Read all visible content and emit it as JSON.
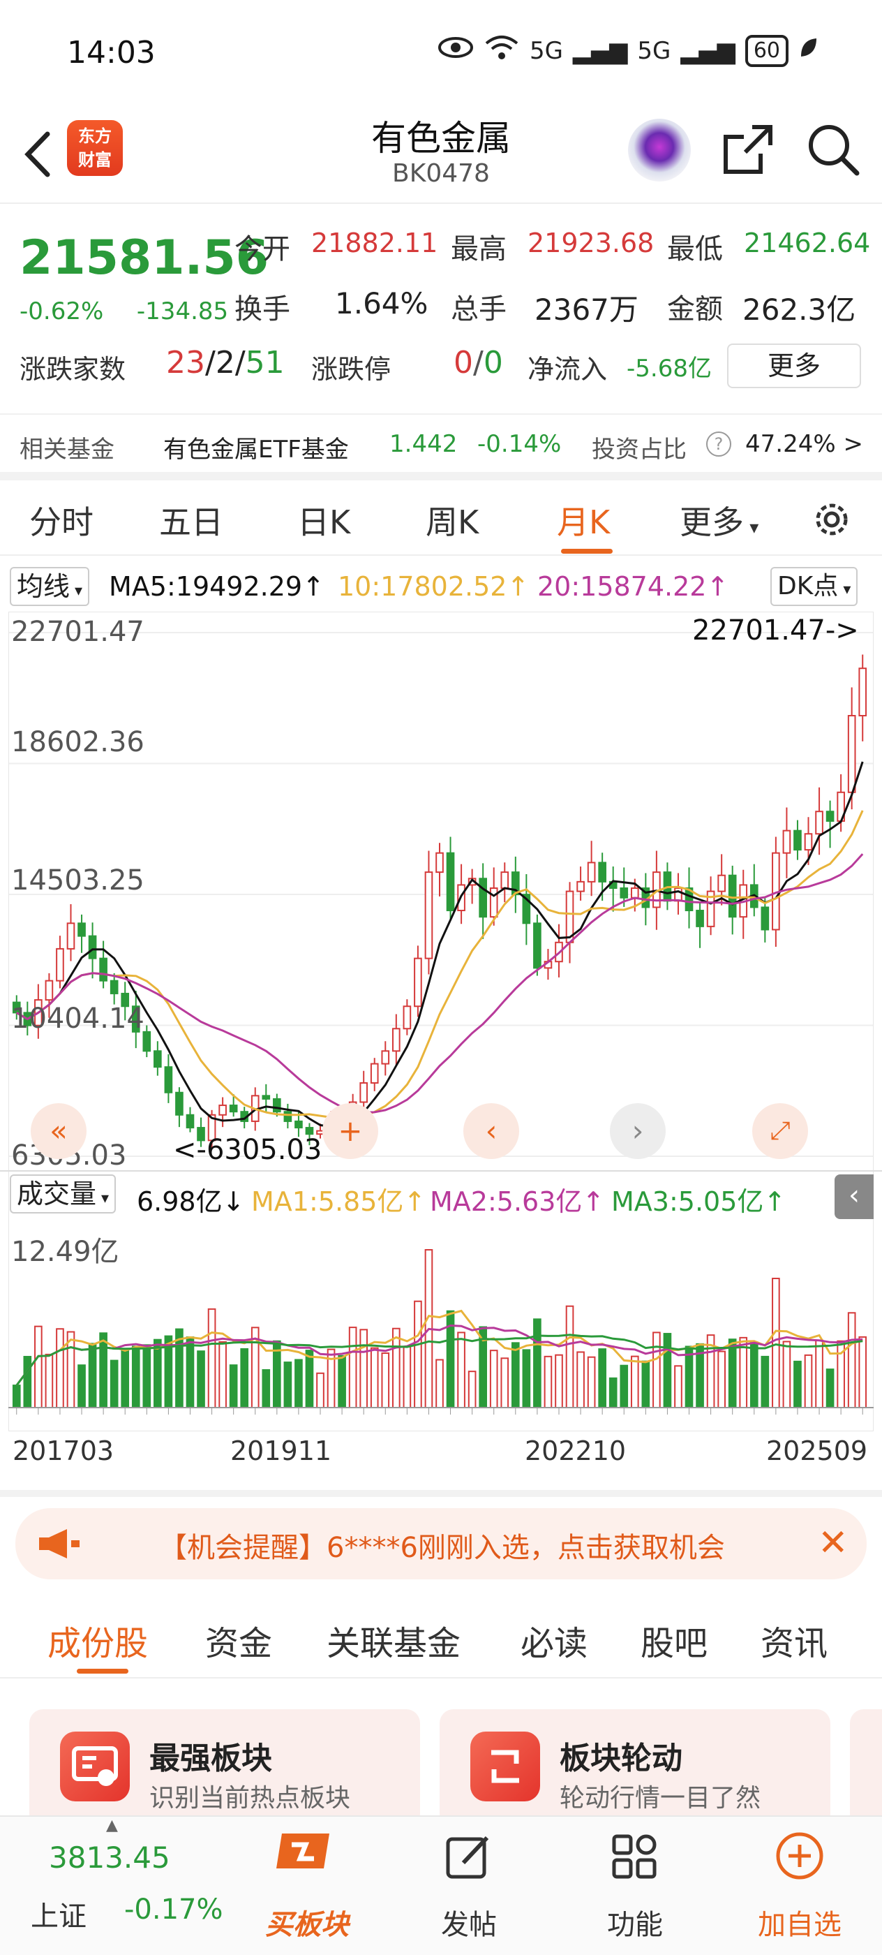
{
  "status_bar": {
    "time": "14:03",
    "battery": "60",
    "signal1": "5G",
    "signal2": "5G"
  },
  "header": {
    "title": "有色金属",
    "code": "BK0478",
    "logo_line1": "东方",
    "logo_line2": "财富"
  },
  "quote": {
    "price": "21581.56",
    "change_pct": "-0.62%",
    "change_abs": "-134.85",
    "open_label": "今开",
    "open": "21882.11",
    "high_label": "最高",
    "high": "21923.68",
    "low_label": "最低",
    "low": "21462.64",
    "turnover_label": "换手",
    "turnover": "1.64%",
    "volume_label": "总手",
    "volume": "2367万",
    "amount_label": "金额",
    "amount": "262.3亿",
    "breadth_label": "涨跌家数",
    "up": "23",
    "flat": "2",
    "down": "51",
    "sep": "/",
    "limit_label": "涨跌停",
    "limit_up": "0",
    "limit_down": "0",
    "netflow_label": "净流入",
    "netflow": "-5.68亿",
    "more": "更多",
    "fund_label": "相关基金",
    "fund_name": "有色金属ETF基金",
    "fund_price": "1.442",
    "fund_change": "-0.14%",
    "ratio_label": "投资占比",
    "ratio": "47.24% >"
  },
  "chart_tabs": [
    "分时",
    "五日",
    "日K",
    "周K",
    "月K",
    "更多"
  ],
  "chart_tabs_active": 4,
  "ma_row": {
    "selector": "均线",
    "ma5": "MA5:19492.29↑",
    "ma10": "10:17802.52↑",
    "ma20": "20:15874.22↑",
    "dk": "DK点"
  },
  "price_axis": [
    "22701.47",
    "18602.36",
    "14503.25",
    "10404.14",
    "6305.03"
  ],
  "max_marker": "22701.47->",
  "min_marker": "<-6305.03",
  "volume_row": {
    "selector": "成交量",
    "value": "6.98亿↓",
    "ma1": "MA1:5.85亿↑",
    "ma2": "MA2:5.63亿↑",
    "ma3": "MA3:5.05亿↑",
    "axis_max": "12.49亿"
  },
  "date_axis": [
    "201703",
    "201911",
    "202210",
    "202509"
  ],
  "colors": {
    "up": "#d53a3a",
    "down": "#2a9a3a",
    "ma5": "#111111",
    "ma10": "#e8b33a",
    "ma20": "#b83a9a",
    "accent": "#e8651e"
  },
  "chart_data": {
    "type": "candlestick",
    "period": "monthly",
    "x_range": [
      "201703",
      "202509"
    ],
    "ylim": [
      6305.03,
      22701.47
    ],
    "y_ticks": [
      22701.47,
      18602.36,
      14503.25,
      10404.14,
      6305.03
    ],
    "close_approx": [
      10800,
      10400,
      11200,
      11800,
      12800,
      13600,
      13200,
      12500,
      11800,
      11400,
      11000,
      10200,
      9600,
      9100,
      8300,
      7600,
      7200,
      6800,
      7600,
      7900,
      7700,
      7400,
      8200,
      8100,
      7700,
      7400,
      7200,
      7000,
      7100,
      7400,
      7300,
      8000,
      8600,
      9200,
      9600,
      10300,
      11000,
      12500,
      15200,
      15800,
      14000,
      14800,
      15000,
      13800,
      14700,
      15200,
      14500,
      13600,
      12200,
      12400,
      13000,
      14600,
      14900,
      15500,
      14900,
      14700,
      14400,
      14700,
      14100,
      15200,
      14300,
      14700,
      14000,
      13500,
      14600,
      15100,
      13800,
      14800,
      14100,
      13400,
      15800,
      16500,
      15900,
      16400,
      17100,
      16800,
      17700,
      20100,
      21582
    ],
    "ma_latest": {
      "MA5": 19492.29,
      "MA10": 17802.52,
      "MA20": 15874.22
    },
    "volume": {
      "ylim_max": "12.49亿",
      "latest": "6.98亿",
      "MA1": "5.85亿",
      "MA2": "5.63亿",
      "MA3": "5.05亿"
    }
  },
  "notice": {
    "text": "【机会提醒】6****6刚刚入选，点击获取机会"
  },
  "content_tabs": [
    "成份股",
    "资金",
    "关联基金",
    "必读",
    "股吧",
    "资讯"
  ],
  "content_tabs_active": 0,
  "cards": [
    {
      "title": "最强板块",
      "subtitle": "识别当前热点板块"
    },
    {
      "title": "板块轮动",
      "subtitle": "轮动行情一目了然"
    }
  ],
  "bottom_nav": {
    "index_value": "3813.45",
    "index_name": "上证",
    "index_change": "-0.17%",
    "buy_label": "买板块",
    "post": "发帖",
    "func": "功能",
    "watch": "加自选"
  }
}
